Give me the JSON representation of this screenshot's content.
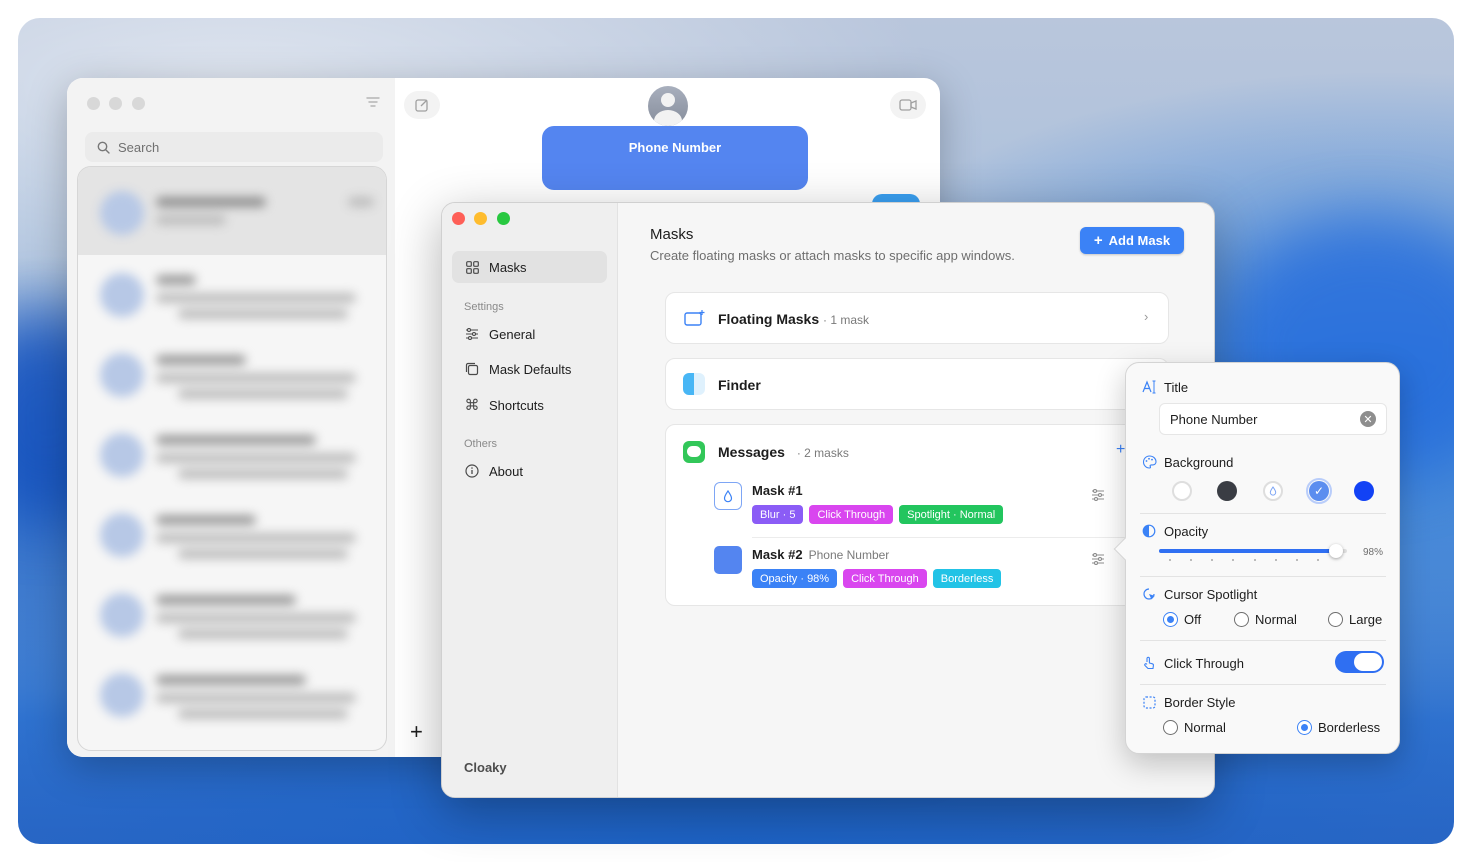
{
  "messages_window": {
    "search_placeholder": "Search",
    "mask_label": "Phone Number",
    "add_label": "+"
  },
  "cloaky": {
    "sidebar": {
      "items": [
        {
          "label": "Masks",
          "icon": "grid-icon",
          "active": true
        }
      ],
      "settings_label": "Settings",
      "settings_items": [
        {
          "label": "General",
          "icon": "sliders-icon"
        },
        {
          "label": "Mask Defaults",
          "icon": "copy-icon"
        },
        {
          "label": "Shortcuts",
          "icon": "command-icon"
        }
      ],
      "others_label": "Others",
      "others_items": [
        {
          "label": "About",
          "icon": "info-icon"
        }
      ],
      "brand": "Cloaky"
    },
    "main": {
      "title": "Masks",
      "subtitle": "Create floating masks or attach masks to specific app windows.",
      "add_button": "Add Mask",
      "floating_card": {
        "title": "Floating Masks",
        "count": "· 1 mask"
      },
      "finder_card": {
        "title": "Finder"
      },
      "messages_card": {
        "title": "Messages",
        "count": "· 2 masks",
        "masks": [
          {
            "title": "Mask #1",
            "subtitle": "",
            "tags": [
              {
                "label": "Blur · 5",
                "color": "#8b5cf6"
              },
              {
                "label": "Click Through",
                "color": "#d946ef"
              },
              {
                "label": "Spotlight · Normal",
                "color": "#22c55e"
              }
            ]
          },
          {
            "title": "Mask #2",
            "subtitle": "Phone Number",
            "tags": [
              {
                "label": "Opacity · 98%",
                "color": "#3b82f6"
              },
              {
                "label": "Click Through",
                "color": "#d946ef"
              },
              {
                "label": "Borderless",
                "color": "#22c3e6"
              }
            ]
          }
        ]
      }
    }
  },
  "popover": {
    "title_label": "Title",
    "title_value": "Phone Number",
    "background_label": "Background",
    "swatches": [
      "#ffffff",
      "#3a3d44",
      "blur",
      "#5b8def",
      "#1242f5"
    ],
    "selected_swatch": 3,
    "opacity_label": "Opacity",
    "opacity_value": "98%",
    "opacity_fraction": 0.98,
    "cursor_spotlight_label": "Cursor Spotlight",
    "cursor_spotlight_options": [
      "Off",
      "Normal",
      "Large"
    ],
    "cursor_spotlight_selected": "Off",
    "click_through_label": "Click Through",
    "click_through_on": true,
    "border_style_label": "Border Style",
    "border_style_options": [
      "Normal",
      "Borderless"
    ],
    "border_style_selected": "Borderless"
  },
  "colors": {
    "accent": "#3b82f6",
    "mask": "#5485f0"
  }
}
